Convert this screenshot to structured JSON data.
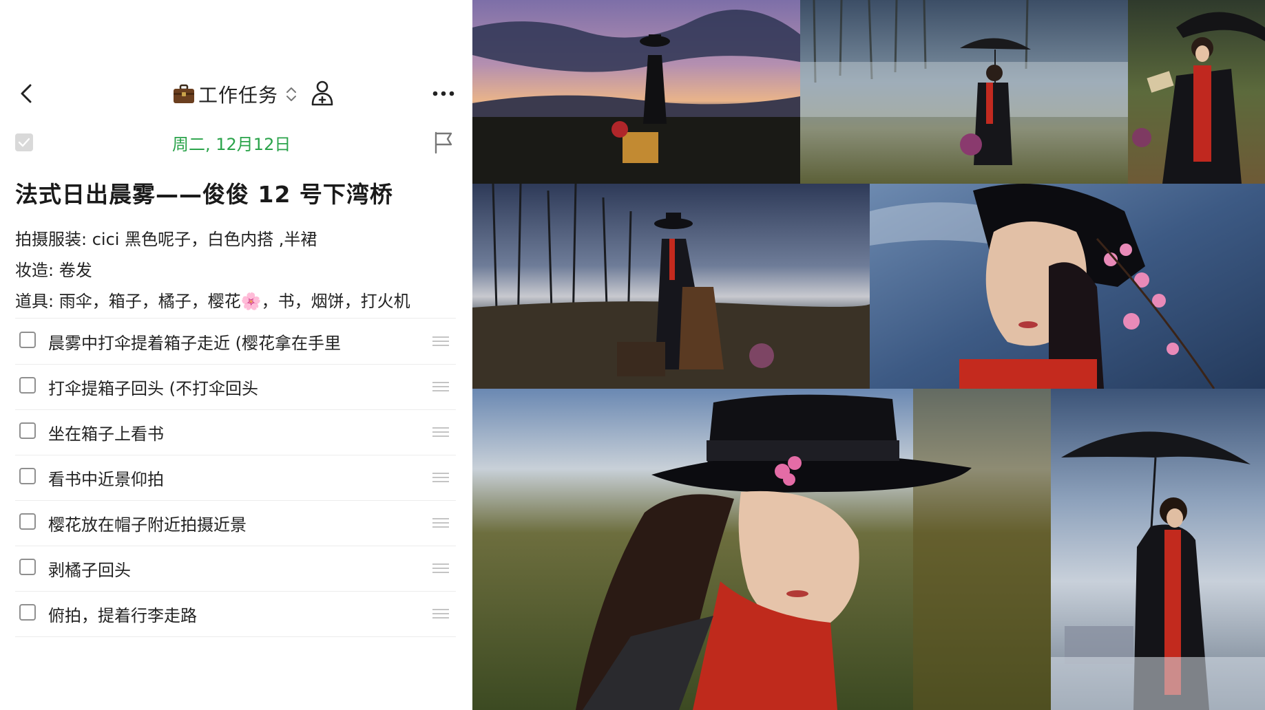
{
  "header": {
    "list_title": "工作任务",
    "briefcase_icon": "briefcase-emoji",
    "back_icon": "chevron-left-icon",
    "sort_icon": "chevron-updown-icon",
    "share_icon": "share-person-icon",
    "more_icon": "ellipsis-icon"
  },
  "task": {
    "date": "周二, 12月12日",
    "date_color": "#2aa34a",
    "title": "法式日出晨雾——俊俊 12 号下湾桥",
    "notes": [
      "拍摄服装: cici 黑色呢子，白色内搭 ,半裙",
      "妆造: 卷发",
      "道具: 雨伞，箱子，橘子，樱花🌸，书，烟饼，打火机"
    ]
  },
  "subtasks": [
    {
      "label": "晨雾中打伞提着箱子走近 (樱花拿在手里"
    },
    {
      "label": "打伞提箱子回头 (不打伞回头"
    },
    {
      "label": "坐在箱子上看书"
    },
    {
      "label": "看书中近景仰拍"
    },
    {
      "label": "樱花放在帽子附近拍摄近景"
    },
    {
      "label": "剥橘子回头"
    },
    {
      "label": "俯拍，提着行李走路"
    }
  ],
  "collage": {
    "photos": [
      "sunrise-silhouette-with-suitcase",
      "umbrella-in-misty-field",
      "reading-book-with-umbrella",
      "sitting-on-suitcase-by-trees",
      "upward-portrait-with-blossoms",
      "closeup-hat-with-flower",
      "standing-with-umbrella-in-fog"
    ]
  }
}
